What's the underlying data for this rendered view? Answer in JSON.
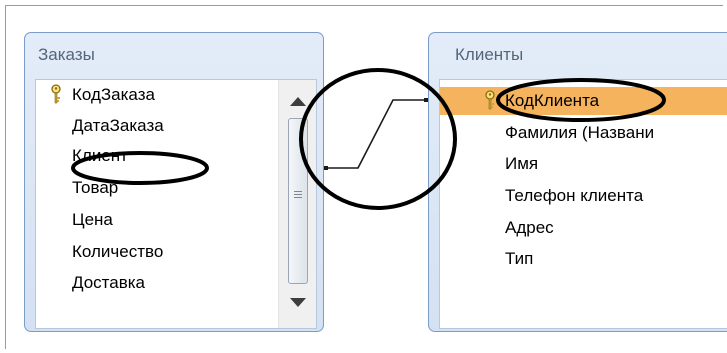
{
  "left_table": {
    "title": "Заказы",
    "fields": [
      "КодЗаказа",
      "ДатаЗаказа",
      "Клиент",
      "Товар",
      "Цена",
      "Количество",
      "Доставка"
    ]
  },
  "right_table": {
    "title": "Клиенты",
    "fields": [
      "КодКлиента",
      "Фамилия (Названи",
      "Имя",
      "Телефон клиента",
      "Адрес",
      "Тип"
    ]
  },
  "icons": {
    "primary_key": "key-icon",
    "scroll_up": "scroll-up-arrow-icon",
    "scroll_down": "scroll-down-arrow-icon"
  },
  "colors": {
    "selected_row": "#f6b35d",
    "table_border": "#7a9cc6",
    "title_text": "#55657a"
  }
}
